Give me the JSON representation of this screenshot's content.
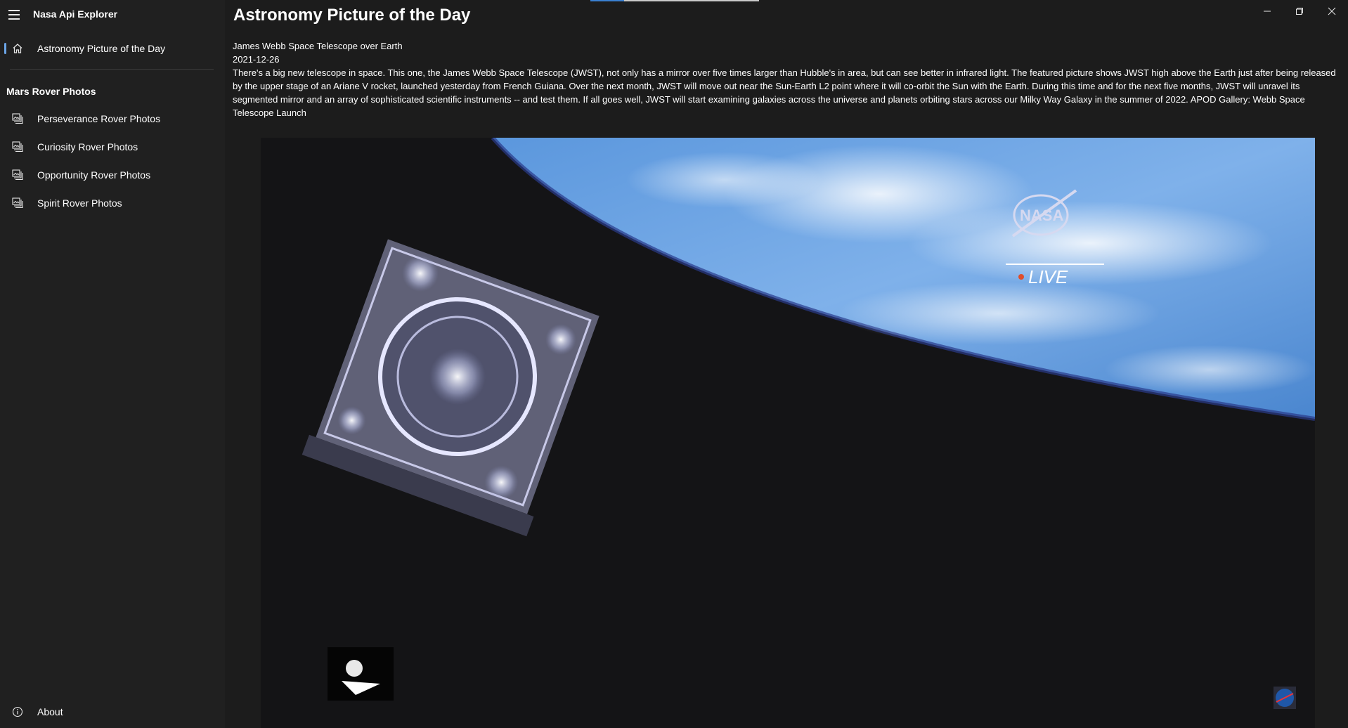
{
  "app": {
    "title": "Nasa Api Explorer"
  },
  "sidebar": {
    "top_items": [
      {
        "label": "Astronomy Picture of the Day",
        "icon": "home-icon",
        "selected": true
      }
    ],
    "section_title": "Mars Rover Photos",
    "rover_items": [
      {
        "label": "Perseverance Rover Photos",
        "icon": "photo-collection-icon"
      },
      {
        "label": "Curiosity Rover Photos",
        "icon": "photo-collection-icon"
      },
      {
        "label": "Opportunity Rover Photos",
        "icon": "photo-collection-icon"
      },
      {
        "label": "Spirit Rover Photos",
        "icon": "photo-collection-icon"
      }
    ],
    "footer_item": {
      "label": "About",
      "icon": "info-icon"
    }
  },
  "main": {
    "page_title": "Astronomy Picture of the Day",
    "apod": {
      "title": "James Webb Space Telescope over Earth",
      "date": "2021-12-26",
      "explanation": "There's a big new telescope in space. This one, the James Webb Space Telescope (JWST), not only has a mirror over five times larger than Hubble's in area, but can see better in infrared light. The featured picture shows JWST high above the Earth just after being released by the upper stage of an Ariane V rocket, launched yesterday from French Guiana. Over the next month, JWST will move out near the Sun-Earth L2 point where it will co-orbit the Sun with the Earth. During this time and for the next five months, JWST will unravel its segmented mirror and an array of sophisticated scientific instruments -- and test them. If all goes well, JWST will start examining galaxies across the universe and planets orbiting stars across our Milky Way Galaxy in the summer of 2022.   APOD Gallery: Webb Space Telescope Launch",
      "image_overlay_logo_text": "NASA",
      "image_overlay_live_text": "LIVE"
    }
  },
  "window_controls": [
    "minimize-icon",
    "restore-icon",
    "close-icon"
  ],
  "colors": {
    "sidebar_bg": "#202020",
    "main_bg": "#1c1c1c",
    "accent": "#6ba5e7",
    "earth_blue": "#4d8fd9"
  }
}
